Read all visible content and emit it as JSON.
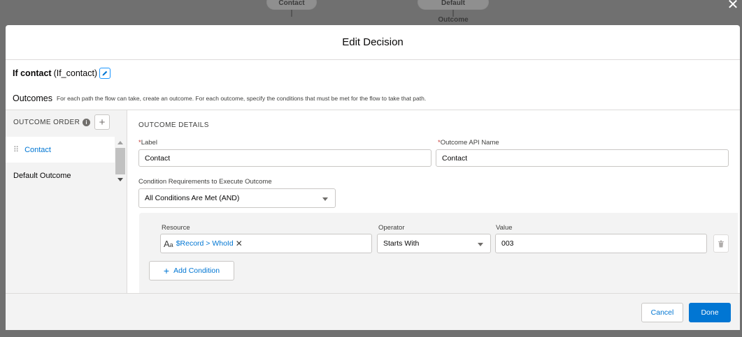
{
  "canvas": {
    "node_left": "Contact",
    "node_right": "Default Outcome"
  },
  "modal": {
    "title": "Edit Decision",
    "element_label": "If contact",
    "element_api": "(If_contact)",
    "outcomes_title": "Outcomes",
    "outcomes_desc": "For each path the flow can take, create an outcome. For each outcome, specify the conditions that must be met for the flow to take that path."
  },
  "sidebar": {
    "order_header": "OUTCOME ORDER",
    "items": [
      {
        "label": "Contact",
        "active": true
      },
      {
        "label": "Default Outcome",
        "active": false
      }
    ]
  },
  "details": {
    "header": "OUTCOME DETAILS",
    "label_field": {
      "label": "Label",
      "value": "Contact"
    },
    "api_field": {
      "label": "Outcome API Name",
      "value": "Contact"
    },
    "requirements": {
      "label": "Condition Requirements to Execute Outcome",
      "value": "All Conditions Are Met (AND)"
    },
    "condition": {
      "resource_label": "Resource",
      "resource_value": "$Record > WhoId",
      "operator_label": "Operator",
      "operator_value": "Starts With",
      "value_label": "Value",
      "value_value": "003"
    },
    "add_condition": "Add Condition"
  },
  "footer": {
    "cancel": "Cancel",
    "done": "Done"
  },
  "colors": {
    "brand": "#0176d3",
    "required": "#c23934",
    "panel_gray": "#f3f3f3"
  }
}
